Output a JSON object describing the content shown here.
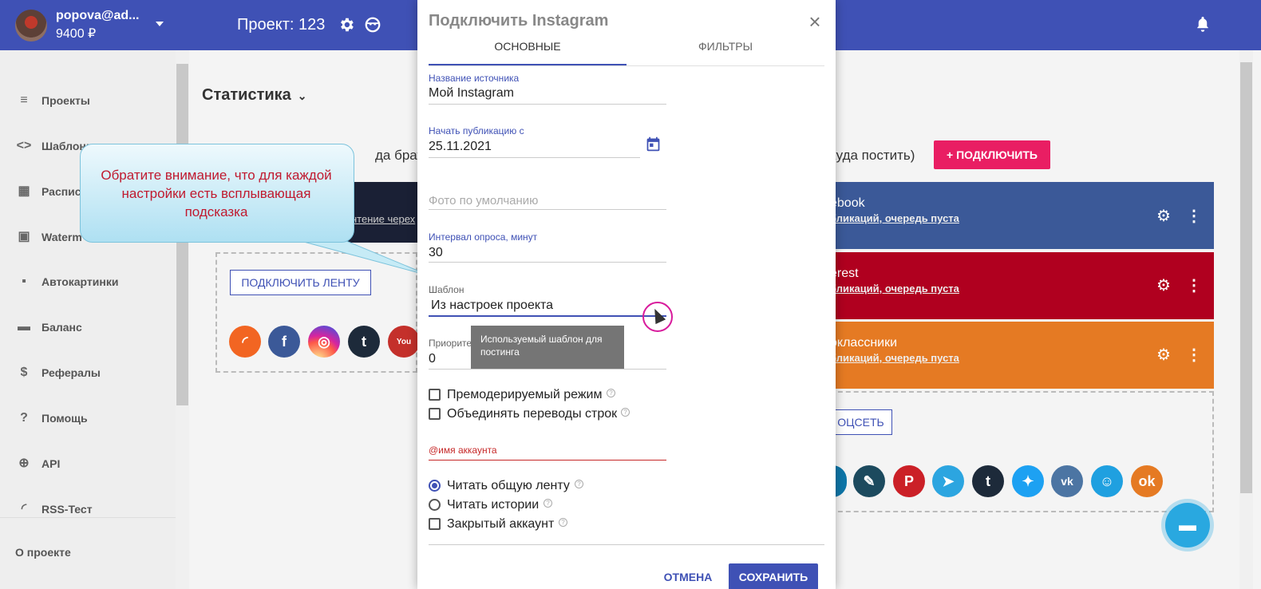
{
  "header": {
    "user_email": "popova@ad...",
    "user_balance": "9400 ₽",
    "project_title": "Проект: 123"
  },
  "sidebar": {
    "items": [
      {
        "label": "Проекты",
        "icon": "list-icon"
      },
      {
        "label": "Шаблоны",
        "icon": "code-icon"
      },
      {
        "label": "Расписа",
        "icon": "calendar-icon"
      },
      {
        "label": "Waterm",
        "icon": "image-icon"
      },
      {
        "label": "Автокартинки",
        "icon": "autoimage-icon"
      },
      {
        "label": "Баланс",
        "icon": "card-icon"
      },
      {
        "label": "Рефералы",
        "icon": "dollar-icon"
      },
      {
        "label": "Помощь",
        "icon": "help-icon"
      },
      {
        "label": "API",
        "icon": "api-icon"
      },
      {
        "label": "RSS-Тест",
        "icon": "rss-icon"
      }
    ],
    "about": "О проекте"
  },
  "main": {
    "stats_title": "Статистика",
    "sources_title": "да брать)",
    "destinations_title": "куда постить)",
    "connect_button": "+ ПОДКЛЮЧИТЬ",
    "dark_card_link": "нтение черех",
    "connect_feed_button": "ПОДКЛЮЧИТЬ ЛЕНТУ",
    "social_button": "ОЦСЕТЬ",
    "destinations": [
      {
        "name": "ebook",
        "sub": "бликаций, очередь пуста",
        "color": "#3b5998"
      },
      {
        "name": "erest",
        "sub": "бликаций, очередь пуста",
        "color": "#b0001f"
      },
      {
        "name": "оклассники",
        "sub": "бликаций, очередь пуста",
        "color": "#e57a23"
      }
    ]
  },
  "callout": {
    "text": "Обратите внимание, что для каждой настройки есть всплывающая подсказка"
  },
  "modal": {
    "title": "Подключить Instagram",
    "tabs": [
      "ОСНОВНЫЕ",
      "ФИЛЬТРЫ"
    ],
    "fields": {
      "source_name_label": "Название источника",
      "source_name_value": "Мой Instagram",
      "start_label": "Начать публикацию с",
      "start_value": "25.11.2021",
      "photo_placeholder": "Фото по умолчанию",
      "interval_label": "Интервал опроса, минут",
      "interval_value": "30",
      "template_label": "Шаблон",
      "template_value": "Из настроек проекта",
      "priority_label": "Приорите",
      "priority_value": "0",
      "account_label": "@имя аккаунта"
    },
    "tooltip": "Используемый шаблон для постинга",
    "checkboxes": {
      "premoderation": "Премодерируемый режим",
      "merge_lines": "Объединять переводы строк",
      "closed_account": "Закрытый аккаунт"
    },
    "radios": {
      "read_feed": "Читать общую ленту",
      "read_stories": "Читать истории"
    },
    "buttons": {
      "cancel": "ОТМЕНА",
      "save": "СОХРАНИТЬ"
    }
  }
}
